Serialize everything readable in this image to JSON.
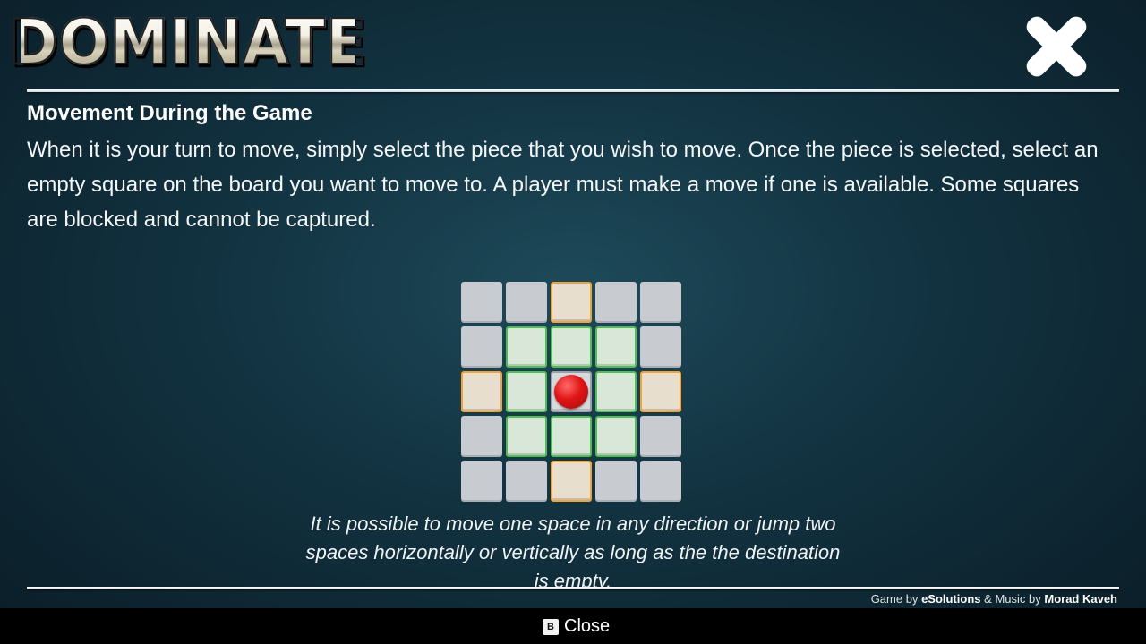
{
  "header": {
    "logo_text": "DOMINATE",
    "close_icon": "close-x-icon"
  },
  "section": {
    "title": "Movement During the Game",
    "body": "When it is your turn to move, simply select the piece that you wish to move. Once the piece is selected, select an empty square on the board you want to move to. A player must make a move if one is available. Some squares are blocked and cannot be captured."
  },
  "board": {
    "rows": [
      [
        "plain",
        "plain",
        "jump",
        "plain",
        "plain"
      ],
      [
        "plain",
        "near",
        "near",
        "near",
        "plain"
      ],
      [
        "jump",
        "near",
        "piece",
        "near",
        "jump"
      ],
      [
        "plain",
        "near",
        "near",
        "near",
        "plain"
      ],
      [
        "plain",
        "plain",
        "jump",
        "plain",
        "plain"
      ]
    ],
    "piece_color": "#e01515",
    "near_color": "#4fbf4f",
    "jump_color": "#f1a23a"
  },
  "caption": {
    "text": "It is possible to move one space in any direction or jump two spaces horizontally or vertically as long as the the destination is empty."
  },
  "credits": {
    "game_prefix": "Game by",
    "game_by": "eSolutions",
    "separator": "&",
    "music_prefix": "Music by",
    "music_by": "Morad Kaveh"
  },
  "footer": {
    "button_key": "B",
    "close_label": "Close"
  }
}
